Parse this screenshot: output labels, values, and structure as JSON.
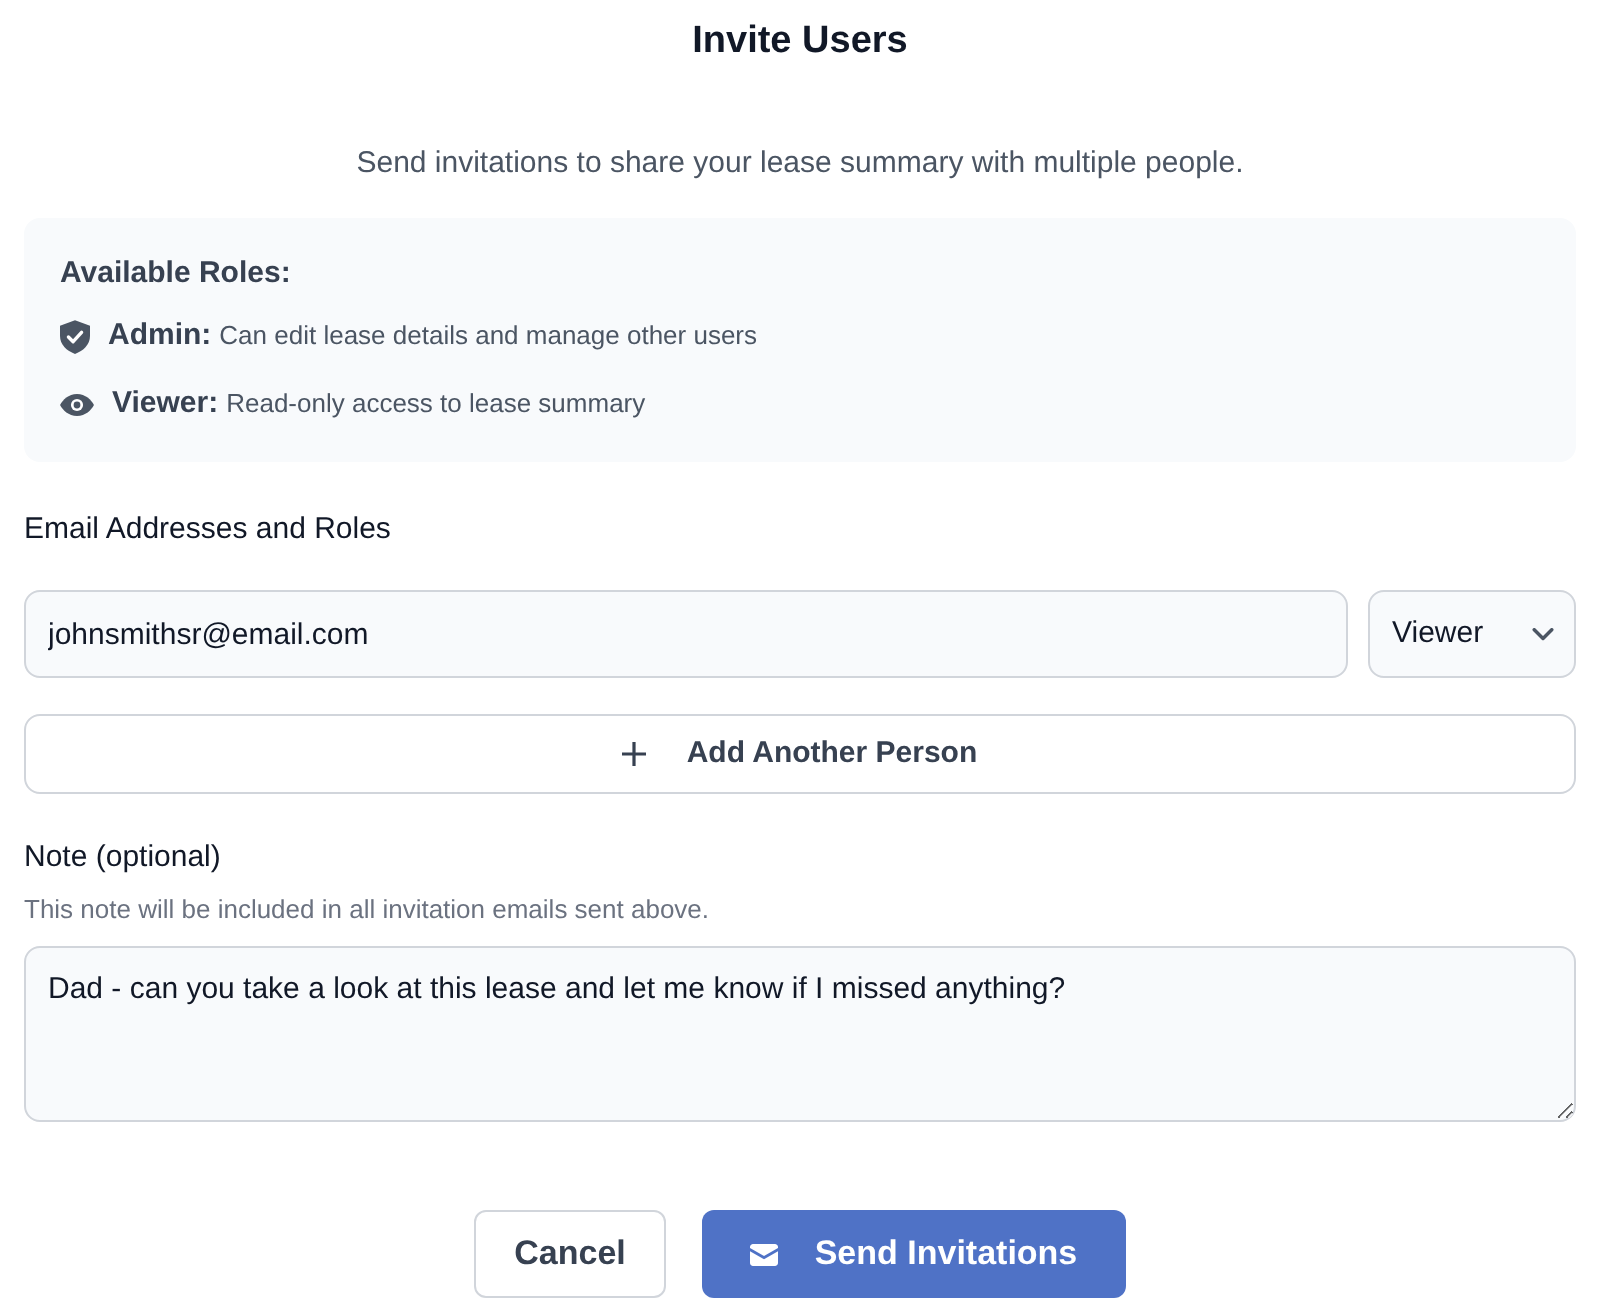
{
  "dialog": {
    "title": "Invite Users",
    "subtitle": "Send invitations to share your lease summary with multiple people."
  },
  "roles_panel": {
    "heading": "Available Roles:",
    "roles": [
      {
        "kind": "admin",
        "name": "Admin:",
        "description": "Can edit lease details and manage other users"
      },
      {
        "kind": "viewer",
        "name": "Viewer:",
        "description": "Read-only access to lease summary"
      }
    ]
  },
  "invitees": {
    "label": "Email Addresses and Roles",
    "rows": [
      {
        "email": "johnsmithsr@email.com",
        "role": "Viewer"
      }
    ],
    "add_button": "Add Another Person"
  },
  "note": {
    "label": "Note (optional)",
    "hint": "This note will be included in all invitation emails sent above.",
    "value": "Dad - can you take a look at this lease and let me know if I missed anything?"
  },
  "actions": {
    "cancel": "Cancel",
    "submit": "Send Invitations"
  }
}
